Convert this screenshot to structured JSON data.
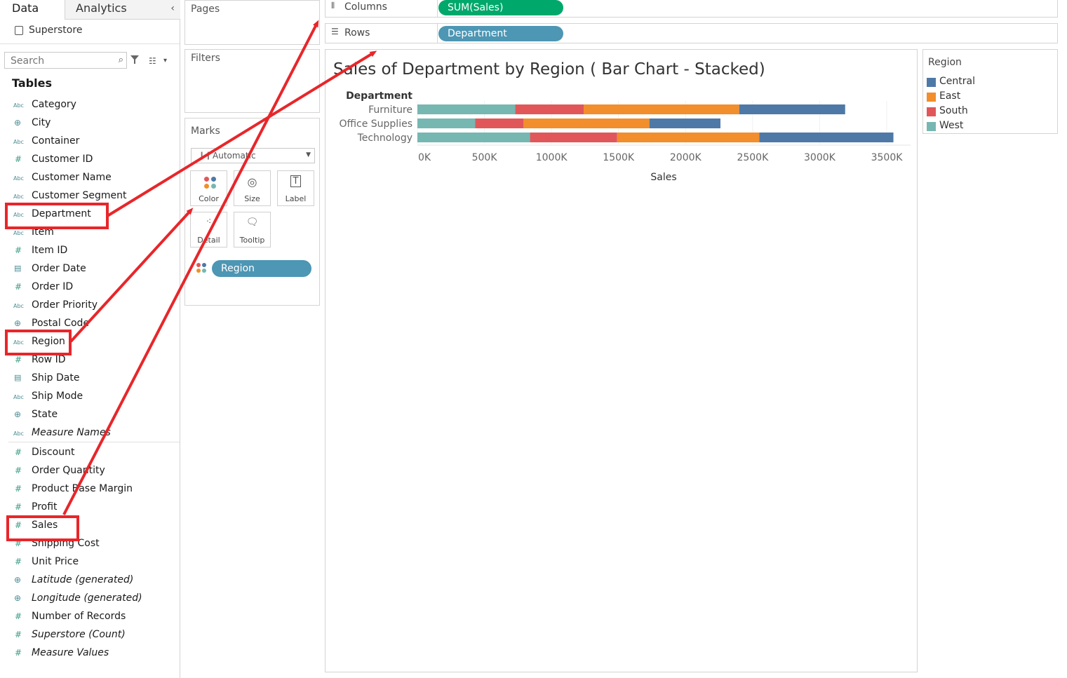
{
  "left_pane": {
    "tabs": {
      "data": "Data",
      "analytics": "Analytics",
      "collapse_icon": "chevron-left-icon"
    },
    "datasource": "Superstore",
    "search": {
      "placeholder": "Search",
      "value": ""
    },
    "tables_heading": "Tables",
    "dimensions": [
      {
        "label": "Category",
        "type": "abc",
        "italic": false
      },
      {
        "label": "City",
        "type": "globe",
        "italic": false
      },
      {
        "label": "Container",
        "type": "abc",
        "italic": false
      },
      {
        "label": "Customer ID",
        "type": "hash",
        "italic": false
      },
      {
        "label": "Customer Name",
        "type": "abc",
        "italic": false
      },
      {
        "label": "Customer Segment",
        "type": "abc",
        "italic": false
      },
      {
        "label": "Department",
        "type": "abc",
        "italic": false
      },
      {
        "label": "Item",
        "type": "abc",
        "italic": false
      },
      {
        "label": "Item ID",
        "type": "hash",
        "italic": false
      },
      {
        "label": "Order Date",
        "type": "calendar",
        "italic": false
      },
      {
        "label": "Order ID",
        "type": "hash",
        "italic": false
      },
      {
        "label": "Order Priority",
        "type": "abc",
        "italic": false
      },
      {
        "label": "Postal Code",
        "type": "globe",
        "italic": false
      },
      {
        "label": "Region",
        "type": "abc",
        "italic": false
      },
      {
        "label": "Row ID",
        "type": "hash",
        "italic": false
      },
      {
        "label": "Ship Date",
        "type": "calendar",
        "italic": false
      },
      {
        "label": "Ship Mode",
        "type": "abc",
        "italic": false
      },
      {
        "label": "State",
        "type": "globe",
        "italic": false
      },
      {
        "label": "Measure Names",
        "type": "abc",
        "italic": true
      }
    ],
    "measures": [
      {
        "label": "Discount",
        "type": "hash",
        "italic": false
      },
      {
        "label": "Order Quantity",
        "type": "hash",
        "italic": false
      },
      {
        "label": "Product Base Margin",
        "type": "hash",
        "italic": false
      },
      {
        "label": "Profit",
        "type": "hash",
        "italic": false
      },
      {
        "label": "Sales",
        "type": "hash",
        "italic": false
      },
      {
        "label": "Shipping Cost",
        "type": "hash",
        "italic": false
      },
      {
        "label": "Unit Price",
        "type": "hash",
        "italic": false
      },
      {
        "label": "Latitude (generated)",
        "type": "globe",
        "italic": true
      },
      {
        "label": "Longitude (generated)",
        "type": "globe",
        "italic": true
      },
      {
        "label": "Number of Records",
        "type": "hash",
        "italic": false
      },
      {
        "label": "Superstore (Count)",
        "type": "hash",
        "italic": true
      },
      {
        "label": "Measure Values",
        "type": "hash",
        "italic": true
      }
    ]
  },
  "cards": {
    "pages": "Pages",
    "filters": "Filters",
    "marks": {
      "title": "Marks",
      "mark_type": "Automatic",
      "buttons": [
        "Color",
        "Size",
        "Label",
        "Detail",
        "Tooltip"
      ],
      "pill": "Region"
    }
  },
  "shelves": {
    "columns": {
      "label": "Columns",
      "pill": "SUM(Sales)"
    },
    "rows": {
      "label": "Rows",
      "pill": "Department"
    }
  },
  "colors": {
    "Central": "#4e79a7",
    "East": "#f28e2b",
    "South": "#e15759",
    "West": "#76b7b2",
    "columns_pill": "#00a86b",
    "dimension_pill": "#4d96b4",
    "annotation": "#e8262a"
  },
  "legend": {
    "title": "Region",
    "items": [
      "Central",
      "East",
      "South",
      "West"
    ]
  },
  "chart_data": {
    "type": "bar",
    "orientation": "horizontal",
    "stacked": true,
    "title": "Sales of Department by Region ( Bar Chart - Stacked)",
    "row_header": "Department",
    "xlabel": "Sales",
    "categories": [
      "Furniture",
      "Office Supplies",
      "Technology"
    ],
    "series": [
      {
        "name": "West",
        "values": [
          730000,
          430000,
          840000
        ]
      },
      {
        "name": "South",
        "values": [
          510000,
          360000,
          650000
        ]
      },
      {
        "name": "East",
        "values": [
          1160000,
          940000,
          1060000
        ]
      },
      {
        "name": "Central",
        "values": [
          790000,
          530000,
          1000000
        ]
      }
    ],
    "xlim": [
      0,
      3500000
    ],
    "x_ticks": [
      "0K",
      "500K",
      "1000K",
      "1500K",
      "2000K",
      "2500K",
      "3000K",
      "3500K"
    ],
    "grid": true,
    "legend_position": "right"
  }
}
